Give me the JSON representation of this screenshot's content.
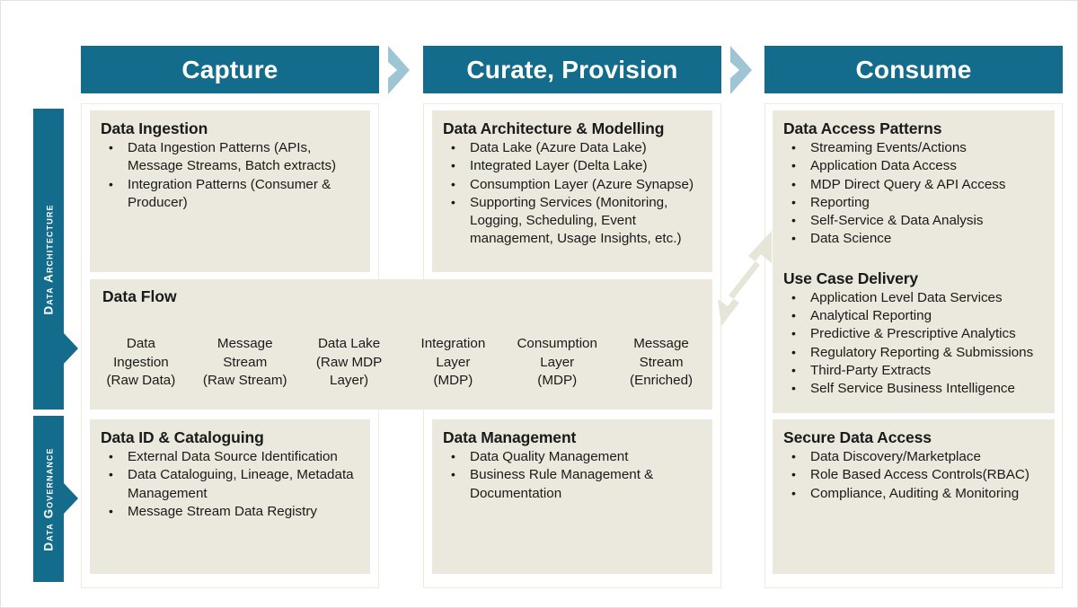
{
  "phases": [
    {
      "id": "capture",
      "label": "Capture"
    },
    {
      "id": "curate",
      "label": "Curate, Provision"
    },
    {
      "id": "consume",
      "label": "Consume"
    }
  ],
  "swimlanes": [
    {
      "id": "architecture",
      "label": "Data Architecture"
    },
    {
      "id": "governance",
      "label": "Data Governance"
    }
  ],
  "panels": {
    "data_ingestion": {
      "title": "Data Ingestion",
      "items": [
        "Data Ingestion Patterns (APIs, Message Streams, Batch extracts)",
        "Integration Patterns (Consumer & Producer)"
      ]
    },
    "data_architecture_modelling": {
      "title": "Data Architecture & Modelling",
      "items": [
        "Data Lake (Azure Data Lake)",
        "Integrated Layer (Delta Lake)",
        "Consumption Layer (Azure Synapse)",
        "Supporting Services (Monitoring, Logging, Scheduling, Event management, Usage Insights, etc.)"
      ]
    },
    "data_access_patterns": {
      "title": "Data Access Patterns",
      "items": [
        "Streaming Events/Actions",
        "Application Data Access",
        "MDP Direct Query & API Access",
        "Reporting",
        "Self-Service & Data Analysis",
        "Data Science"
      ]
    },
    "use_case_delivery": {
      "title": "Use Case Delivery",
      "items": [
        "Application Level Data Services",
        "Analytical Reporting",
        "Predictive & Prescriptive Analytics",
        "Regulatory Reporting & Submissions",
        "Third-Party Extracts",
        "Self Service Business Intelligence"
      ]
    },
    "data_id_cataloguing": {
      "title": "Data ID & Cataloguing",
      "items": [
        "External Data Source Identification",
        "Data Cataloguing, Lineage, Metadata Management",
        "Message Stream Data Registry"
      ]
    },
    "data_management": {
      "title": "Data Management",
      "items": [
        "Data Quality Management",
        "Business Rule Management & Documentation"
      ]
    },
    "secure_data_access": {
      "title": "Secure Data Access",
      "items": [
        "Data Discovery/Marketplace",
        "Role Based Access Controls(RBAC)",
        "Compliance, Auditing & Monitoring"
      ]
    }
  },
  "data_flow": {
    "title": "Data Flow",
    "cells": [
      {
        "lines": [
          "Data",
          "Ingestion",
          "(Raw Data)"
        ]
      },
      {
        "lines": [
          "Message",
          "Stream",
          "(Raw Stream)"
        ]
      },
      {
        "lines": [
          "Data Lake",
          "(Raw MDP",
          "Layer)"
        ]
      },
      {
        "lines": [
          "Integration",
          "Layer",
          "(MDP)"
        ]
      },
      {
        "lines": [
          "Consumption",
          "Layer",
          "(MDP)"
        ]
      },
      {
        "lines": [
          "Message",
          "Stream",
          "(Enriched)"
        ]
      }
    ]
  },
  "colors": {
    "teal": "#136C8B",
    "chevron": "#9DC5D4",
    "panel": "#EBE8DD",
    "arrow": "#E7E4D8",
    "background": "#FFFFFF"
  }
}
